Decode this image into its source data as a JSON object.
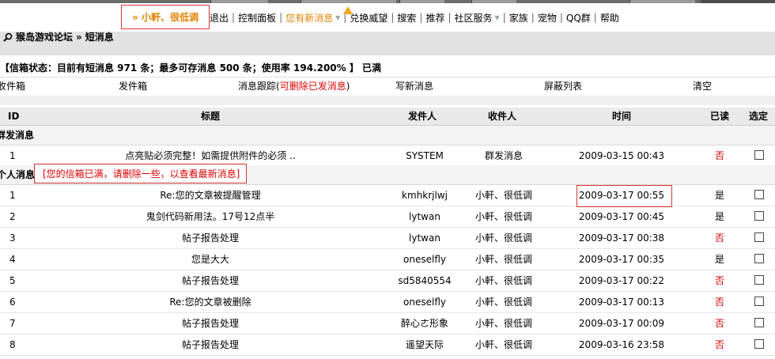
{
  "nav": {
    "user": "» 小軒、很低调",
    "items": [
      "退出",
      "控制面板",
      "您有新消息",
      "兑换威望",
      "搜索",
      "推荐",
      "社区服务",
      "家族",
      "宠物",
      "QQ群",
      "帮助"
    ]
  },
  "breadcrumb": {
    "forum": "猴岛游戏论坛",
    "sep": "»",
    "page": "短消息"
  },
  "status": "【信箱状态：目前有短消息 971 条；最多可存消息 500 条；使用率 194.200% 】 已满",
  "tabs": {
    "inbox": "收件箱",
    "outbox": "发件箱",
    "track": "消息跟踪",
    "track_red": "可删除已发消息",
    "write": "写新消息",
    "block": "屏蔽列表",
    "clear": "清空"
  },
  "table": {
    "headers": {
      "id": "ID",
      "title": "标题",
      "from": "发件人",
      "to": "收件人",
      "time": "时间",
      "read": "已读",
      "select": "选定"
    },
    "group_section": "群发消息",
    "group_rows": [
      {
        "id": "1",
        "title": "点亮贴必须完整！如需提供附件的必须 ..",
        "from": "SYSTEM",
        "to": "群发消息",
        "time": "2009-03-15 00:43",
        "read": "否"
      }
    ],
    "personal_section": "个人消息",
    "notice": "[您的信箱已满，请删除一些，以查看最新消息]",
    "personal_rows": [
      {
        "id": "1",
        "title": "Re:您的文章被提醒管理",
        "from": "kmhkrjlwj",
        "to": "小軒、很低调",
        "time": "2009-03-17 00:55",
        "read": "是"
      },
      {
        "id": "2",
        "title": "鬼剑代码新用法。17号12点半",
        "from": "lytwan",
        "to": "小軒、很低调",
        "time": "2009-03-17 00:45",
        "read": "是"
      },
      {
        "id": "3",
        "title": "帖子报告处理",
        "from": "lytwan",
        "to": "小軒、很低调",
        "time": "2009-03-17 00:38",
        "read": "否"
      },
      {
        "id": "4",
        "title": "您是大大",
        "from": "oneselfly",
        "to": "小軒、很低调",
        "time": "2009-03-17 00:35",
        "read": "是"
      },
      {
        "id": "5",
        "title": "帖子报告处理",
        "from": "sd5840554",
        "to": "小軒、很低调",
        "time": "2009-03-17 00:22",
        "read": "否"
      },
      {
        "id": "6",
        "title": "Re:您的文章被删除",
        "from": "oneselfly",
        "to": "小軒、很低调",
        "time": "2009-03-17 00:13",
        "read": "否"
      },
      {
        "id": "7",
        "title": "帖子报告处理",
        "from": "醉心ㄜ形象",
        "to": "小軒、很低调",
        "time": "2009-03-17 00:09",
        "read": "否"
      },
      {
        "id": "8",
        "title": "帖子报告处理",
        "from": "遥望天际",
        "to": "小軒、很低调",
        "time": "2009-03-16 23:58",
        "read": "否"
      }
    ]
  },
  "colors": {
    "unread": "#dd0000",
    "alert": "#e28100",
    "highlight_border": "#dd3333"
  }
}
